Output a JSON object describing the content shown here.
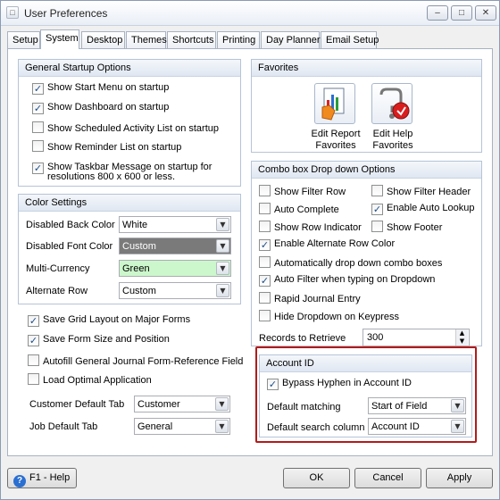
{
  "window": {
    "title": "User Preferences",
    "buttons": {
      "minimize": "–",
      "maximize": "□",
      "close": "✕"
    }
  },
  "tabs": [
    "Setup",
    "System",
    "Desktop",
    "Themes",
    "Shortcuts",
    "Printing",
    "Day Planner",
    "Email Setup"
  ],
  "active_tab": "System",
  "general_startup": {
    "header": "General Startup Options",
    "items": [
      {
        "label": "Show Start Menu on startup",
        "checked": true
      },
      {
        "label": "Show Dashboard on startup",
        "checked": true
      },
      {
        "label": "Show Scheduled Activity List on startup",
        "checked": false
      },
      {
        "label": "Show Reminder List on startup",
        "checked": false
      },
      {
        "label": "Show Taskbar Message on startup for",
        "label2": "resolutions 800 x 600 or less.",
        "checked": true
      }
    ]
  },
  "color_settings": {
    "header": "Color Settings",
    "rows": [
      {
        "label": "Disabled Back Color",
        "value": "White",
        "bg": "#ffffff",
        "fg": "#000000"
      },
      {
        "label": "Disabled Font Color",
        "value": "Custom",
        "bg": "#7a7a7a",
        "fg": "#ffffff"
      },
      {
        "label": "Multi-Currency",
        "value": "Green",
        "bg": "#ccf7cc",
        "fg": "#000000"
      },
      {
        "label": "Alternate Row",
        "value": "Custom",
        "bg": "#ffffff",
        "fg": "#000000"
      }
    ]
  },
  "grid_options": [
    {
      "label": "Save Grid Layout on Major Forms",
      "checked": true
    },
    {
      "label": "Save Form Size and Position",
      "checked": true
    },
    {
      "label": "Autofill General Journal Form-Reference Field",
      "checked": false
    },
    {
      "label": "Load Optimal Application",
      "checked": false
    }
  ],
  "default_tabs": [
    {
      "label": "Customer Default Tab",
      "value": "Customer"
    },
    {
      "label": "Job Default Tab",
      "value": "General"
    }
  ],
  "favorites": {
    "header": "Favorites",
    "items": [
      {
        "label1": "Edit Report",
        "label2": "Favorites",
        "icon": "report-favorites-icon"
      },
      {
        "label1": "Edit Help",
        "label2": "Favorites",
        "icon": "help-favorites-icon"
      }
    ]
  },
  "combo_options": {
    "header": "Combo box Drop down Options",
    "left": [
      {
        "label": "Show Filter Row",
        "checked": false
      },
      {
        "label": "Auto Complete",
        "checked": false
      },
      {
        "label": "Show Row Indicator",
        "checked": false
      }
    ],
    "right": [
      {
        "label": "Show Filter Header",
        "checked": false
      },
      {
        "label": "Enable Auto Lookup",
        "checked": true
      },
      {
        "label": "Show Footer",
        "checked": false
      }
    ],
    "full": [
      {
        "label": "Enable Alternate Row Color",
        "checked": true
      },
      {
        "label": "Automatically drop down combo boxes",
        "checked": false
      },
      {
        "label": "Auto Filter when typing on Dropdown",
        "checked": true
      },
      {
        "label": "Rapid Journal Entry",
        "checked": false
      },
      {
        "label": "Hide Dropdown on Keypress",
        "checked": false
      }
    ],
    "records_label": "Records to Retrieve",
    "records_value": "300"
  },
  "account_id": {
    "header": "Account ID",
    "bypass": {
      "label": "Bypass Hyphen in Account ID",
      "checked": true
    },
    "matching_label": "Default matching",
    "matching_value": "Start of Field",
    "search_label": "Default search column",
    "search_value": "Account ID"
  },
  "footer": {
    "help": "F1 - Help",
    "ok": "OK",
    "cancel": "Cancel",
    "apply": "Apply"
  },
  "colors": {
    "highlight": "#b31b1b",
    "accent": "#dfe7f2"
  }
}
